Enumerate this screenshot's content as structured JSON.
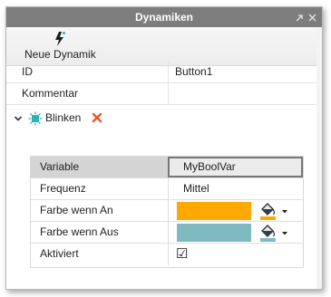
{
  "window": {
    "title": "Dynamiken"
  },
  "toolbar": {
    "new_dynamic_label": "Neue Dynamik",
    "new_dynamic_icon": "new-dynamic-lightning-icon"
  },
  "properties": [
    {
      "key": "ID",
      "value": "Button1"
    },
    {
      "key": "Kommentar",
      "value": ""
    }
  ],
  "effect": {
    "name": "Blinken",
    "icon": "blink-effect-icon",
    "delete_icon": "delete-x-icon",
    "delete_color": "#e8562a"
  },
  "effect_params": {
    "variable": {
      "label": "Variable",
      "value": "MyBoolVar"
    },
    "frequency": {
      "label": "Frequenz",
      "value": "Mittel"
    },
    "color_on": {
      "label": "Farbe wenn An",
      "color": "#ffa800"
    },
    "color_off": {
      "label": "Farbe wenn Aus",
      "color": "#7fbac0"
    },
    "active": {
      "label": "Aktiviert",
      "checked": true,
      "mark": "☑"
    }
  }
}
